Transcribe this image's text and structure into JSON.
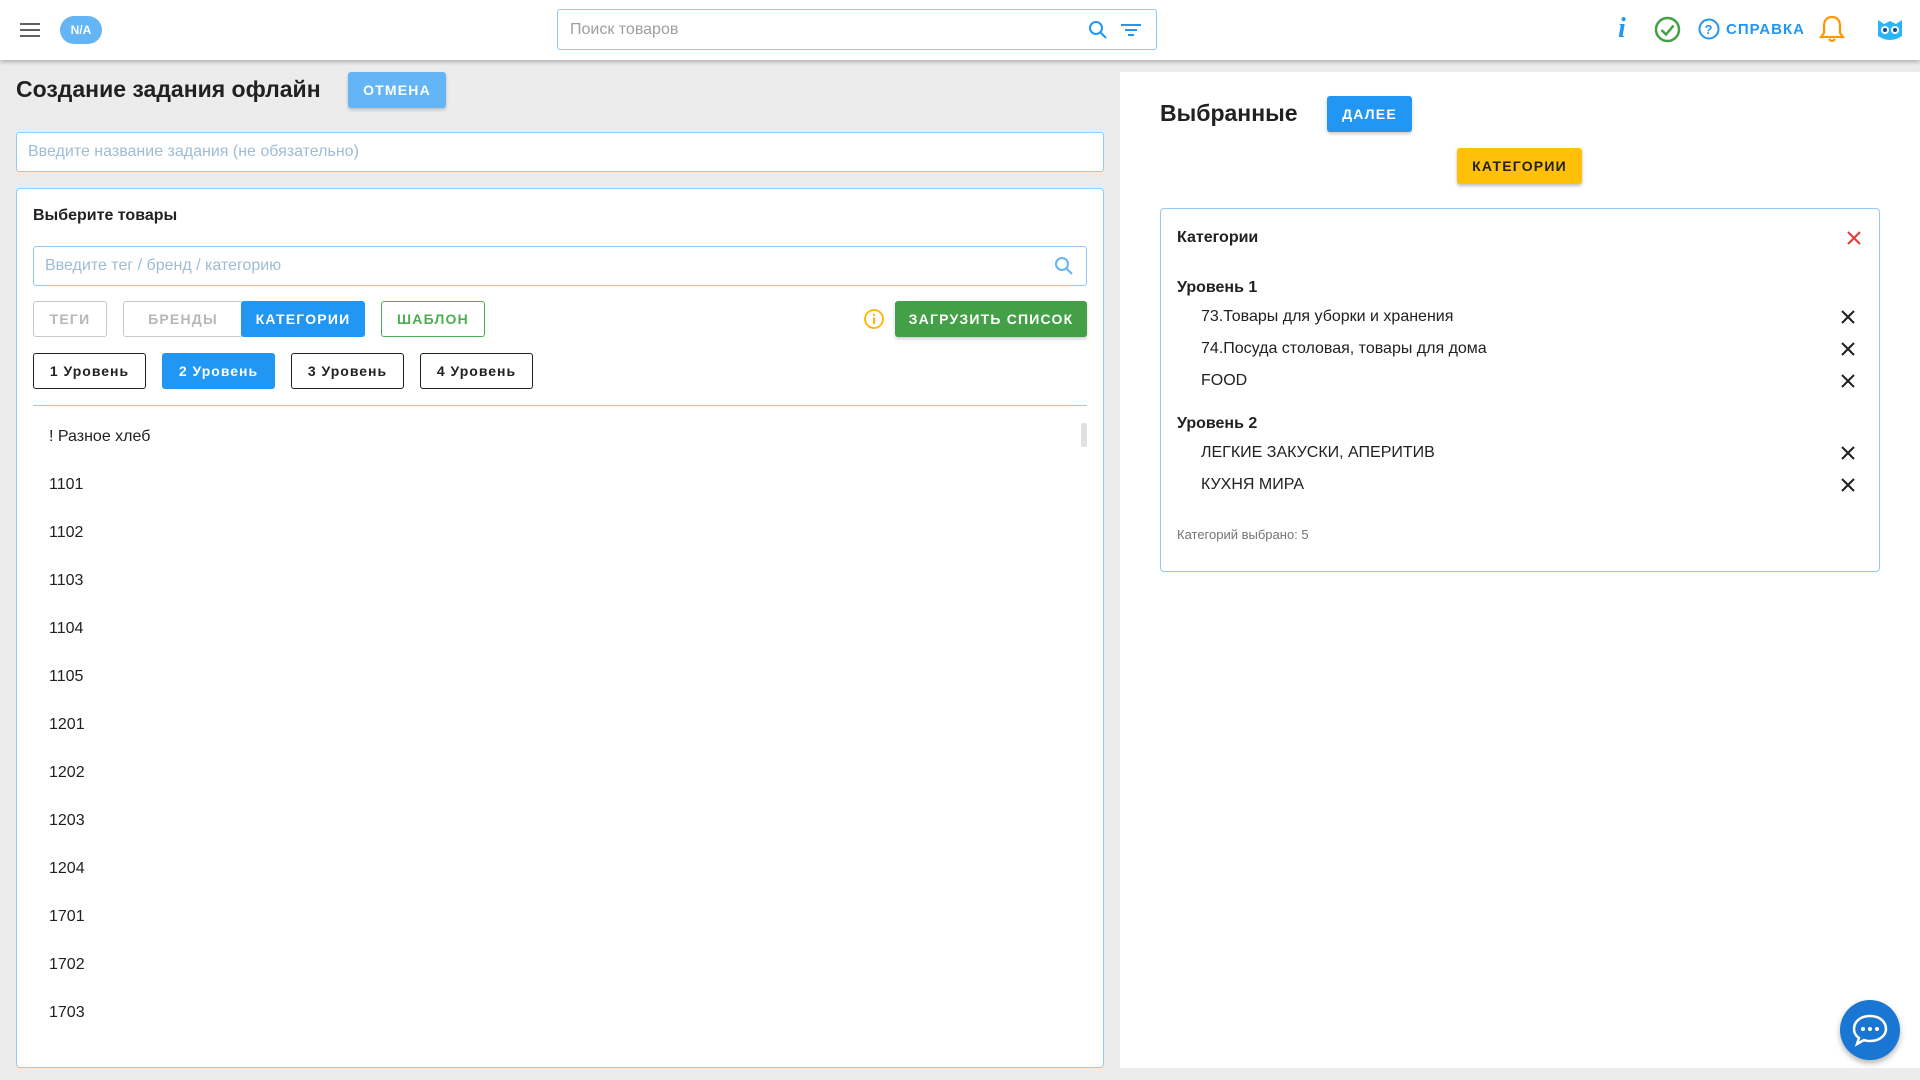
{
  "header": {
    "user_badge": "N/A",
    "search_placeholder": "Поиск товаров",
    "help_label": "СПРАВКА"
  },
  "left": {
    "title": "Создание задания офлайн",
    "cancel_label": "ОТМЕНА",
    "task_name_placeholder": "Введите название задания (не обязательно)",
    "products": {
      "heading": "Выберите товары",
      "tag_search_placeholder": "Введите тег / бренд / категорию",
      "filter_buttons": {
        "tags": "ТЕГИ",
        "brands": "БРЕНДЫ",
        "categories": "КАТЕГОРИИ",
        "template": "ШАБЛОН"
      },
      "upload_label": "ЗАГРУЗИТЬ СПИСОК",
      "levels": [
        "1 Уровень",
        "2 Уровень",
        "3 Уровень",
        "4 Уровень"
      ],
      "active_level": "2 Уровень",
      "items": [
        "! Разное хлеб",
        "1101",
        "1102",
        "1103",
        "1104",
        "1105",
        "1201",
        "1202",
        "1203",
        "1204",
        "1701",
        "1702",
        "1703"
      ]
    }
  },
  "right": {
    "title": "Выбранные",
    "next_label": "ДАЛЕЕ",
    "categories_button": "КАТЕГОРИИ",
    "card": {
      "title": "Категории",
      "groups": [
        {
          "heading": "Уровень 1",
          "items": [
            "73.Товары для уборки и хранения",
            "74.Посуда столовая, товары для дома",
            "FOOD"
          ]
        },
        {
          "heading": "Уровень 2",
          "items": [
            "ЛЕГКИЕ ЗАКУСКИ, АПЕРИТИВ",
            "КУХНЯ МИРА"
          ]
        }
      ],
      "count_text": "Категорий выбрано: 5"
    }
  },
  "colors": {
    "primary": "#2196f3",
    "success": "#43a047",
    "warning": "#ffc107",
    "danger": "#e53935",
    "bell": "#ff9800"
  },
  "icons": [
    "menu-icon",
    "search-icon",
    "filter-icon",
    "info-icon",
    "check-circle-icon",
    "help-circle-icon",
    "bell-icon",
    "logo-icon",
    "close-icon",
    "chat-icon"
  ]
}
